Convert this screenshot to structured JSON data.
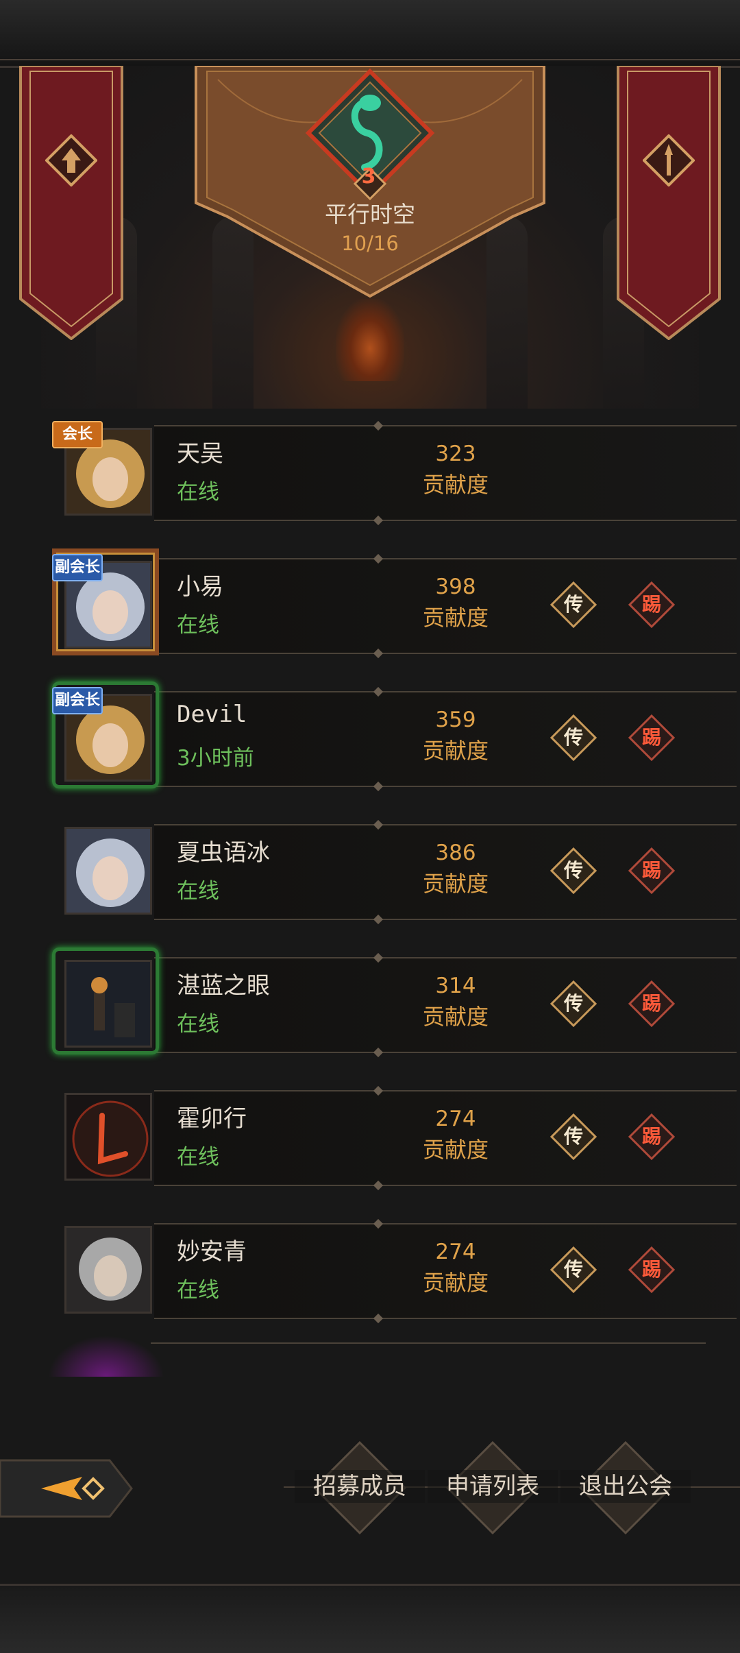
{
  "guild": {
    "name": "平行时空",
    "member_count": "10/16",
    "level": "3"
  },
  "members": [
    {
      "name": "天吴",
      "status": "在线",
      "contribution": "323",
      "contribution_label": "贡献度",
      "role": "会长"
    },
    {
      "name": "小易",
      "status": "在线",
      "contribution": "398",
      "contribution_label": "贡献度",
      "role": "副会长",
      "pass_label": "传",
      "kick_label": "踢"
    },
    {
      "name": "Devil",
      "status": "3小时前",
      "contribution": "359",
      "contribution_label": "贡献度",
      "role": "副会长",
      "pass_label": "传",
      "kick_label": "踢"
    },
    {
      "name": "夏虫语冰",
      "status": "在线",
      "contribution": "386",
      "contribution_label": "贡献度",
      "pass_label": "传",
      "kick_label": "踢"
    },
    {
      "name": "湛蓝之眼",
      "status": "在线",
      "contribution": "314",
      "contribution_label": "贡献度",
      "pass_label": "传",
      "kick_label": "踢"
    },
    {
      "name": "霍卯行",
      "status": "在线",
      "contribution": "274",
      "contribution_label": "贡献度",
      "pass_label": "传",
      "kick_label": "踢"
    },
    {
      "name": "妙安青",
      "status": "在线",
      "contribution": "274",
      "contribution_label": "贡献度",
      "pass_label": "传",
      "kick_label": "踢"
    }
  ],
  "actions": {
    "recruit": "招募成员",
    "applications": "申请列表",
    "leave": "退出公会"
  },
  "icons": {
    "back": "back-arrow-icon",
    "left_banner": "arrow-up-emblem-icon",
    "right_banner": "sword-emblem-icon",
    "guild_emblem": "snake-emblem-icon"
  },
  "colors": {
    "online": "#6ec05c",
    "contribution": "#e0a24a",
    "kick": "#ff5a3a",
    "banner": "#7a1e22"
  }
}
